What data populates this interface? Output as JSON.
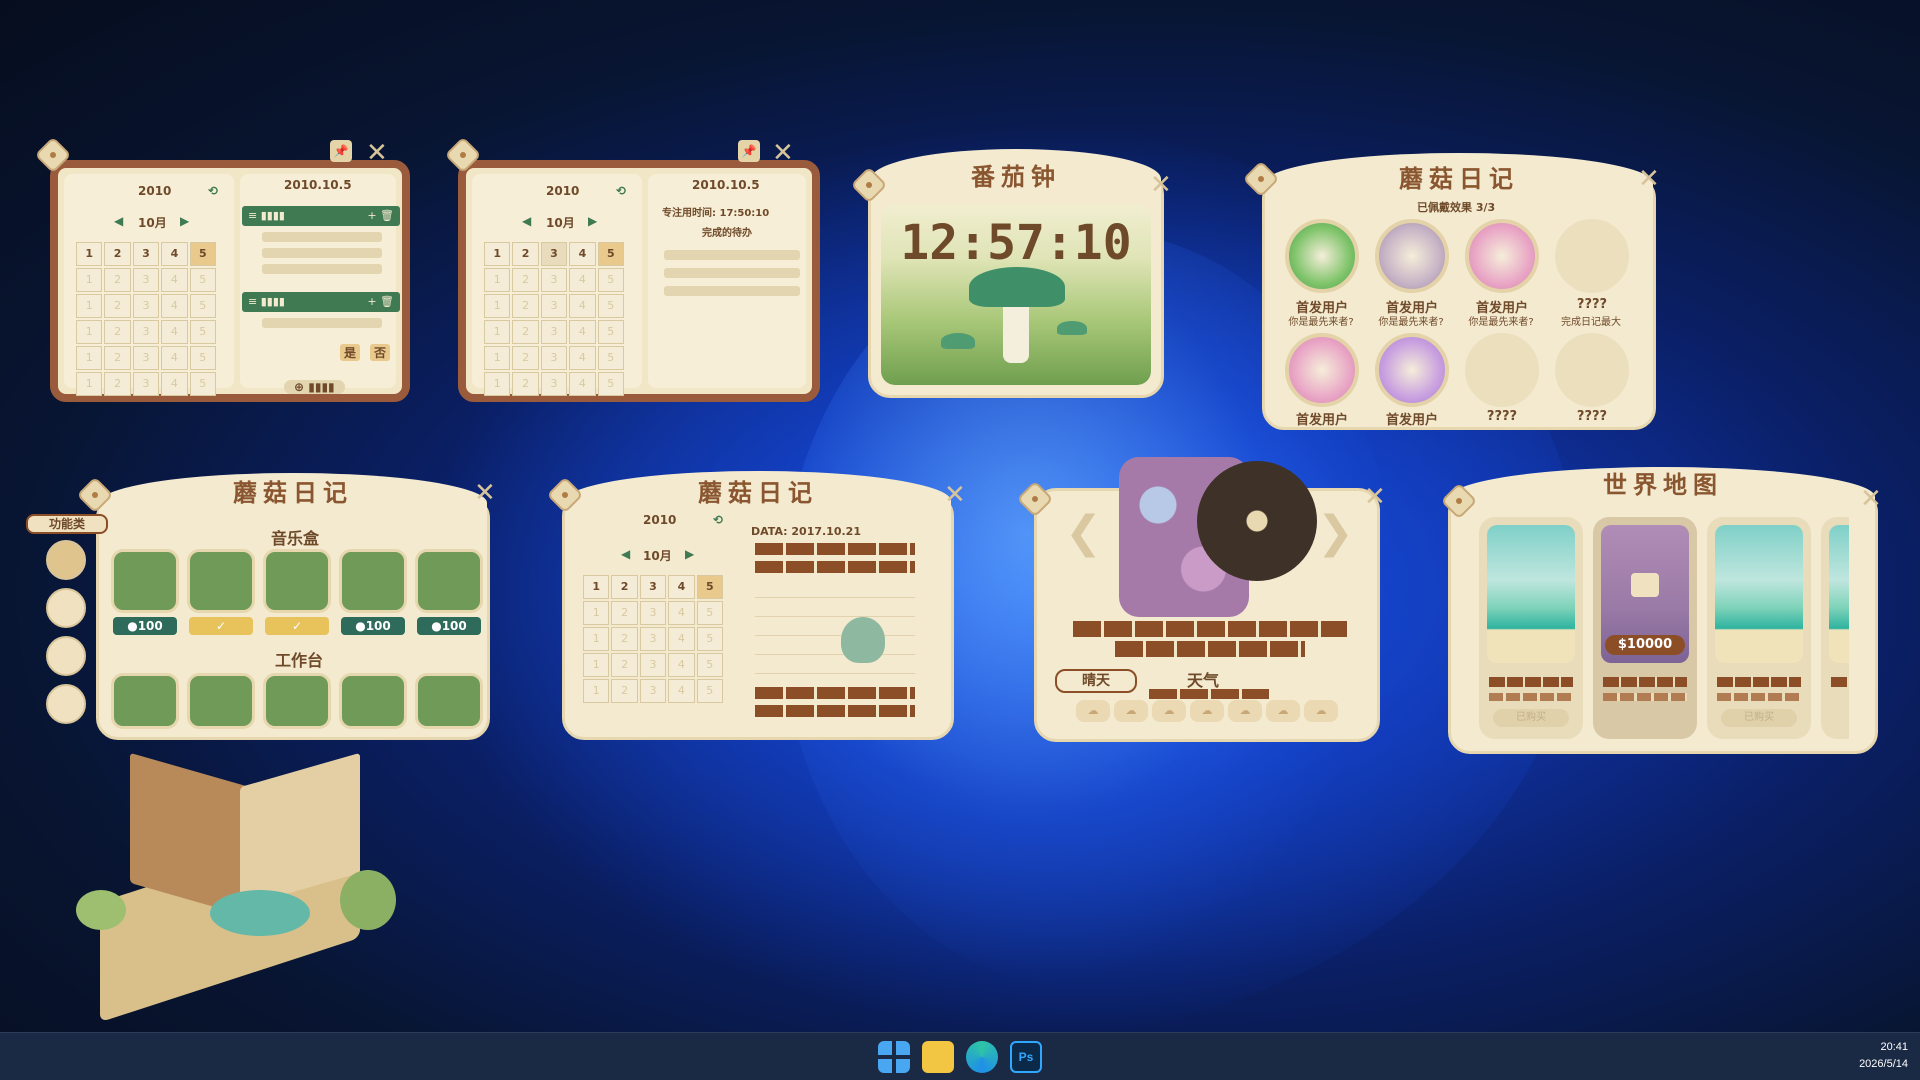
{
  "desktop": {
    "wallpaper": "windows-11-bloom"
  },
  "calendar_task": {
    "year": "2010",
    "date": "2010.10.5",
    "month": "10月",
    "selected_day": "5",
    "group1": "≡ ▮▮▮▮",
    "group2": "≡ ▮▮▮▮",
    "add_delete": "+ 🗑",
    "yes": "是",
    "no": "否",
    "add_button": "⊕ ▮▮▮▮"
  },
  "calendar_focus": {
    "year": "2010",
    "date": "2010.10.5",
    "month": "10月",
    "selected_day": "5",
    "focus_time": "专注用时间: 17:50:10",
    "completed_label": "完成的待办"
  },
  "tomato_clock": {
    "title": "番茄钟",
    "time": "12:57:10"
  },
  "achievements": {
    "title": "蘑菇日记",
    "progress": "已佩戴效果 3/3",
    "items": [
      {
        "name": "首发用户",
        "desc": "你是最先来者?"
      },
      {
        "name": "首发用户",
        "desc": "你是最先来者?"
      },
      {
        "name": "首发用户",
        "desc": "你是最先来者?"
      },
      {
        "name": "????",
        "desc": "完成日记最大"
      },
      {
        "name": "首发用户",
        "desc": ""
      },
      {
        "name": "首发用户",
        "desc": ""
      },
      {
        "name": "????",
        "desc": ""
      },
      {
        "name": "????",
        "desc": ""
      }
    ]
  },
  "music_box": {
    "title": "蘑菇日记",
    "tab_label": "功能类",
    "section1": "音乐盒",
    "section2": "工作台",
    "prices": [
      "●100",
      "✓",
      "✓",
      "●100",
      "●100"
    ]
  },
  "diary": {
    "title": "蘑菇日记",
    "year": "2010",
    "month": "10月",
    "selected_day": "5",
    "data_label": "DATA: 2017.10.21"
  },
  "music_player": {
    "weather_tag": "晴天",
    "weather_label": "天气"
  },
  "world_map": {
    "title": "世界地图",
    "locked_price": "$10000",
    "owned": "已购买"
  },
  "taskbar": {
    "time": "20:41",
    "date": "2026/5/14",
    "apps": [
      "start",
      "file-explorer",
      "edge",
      "photoshop"
    ],
    "ps_label": "Ps"
  }
}
